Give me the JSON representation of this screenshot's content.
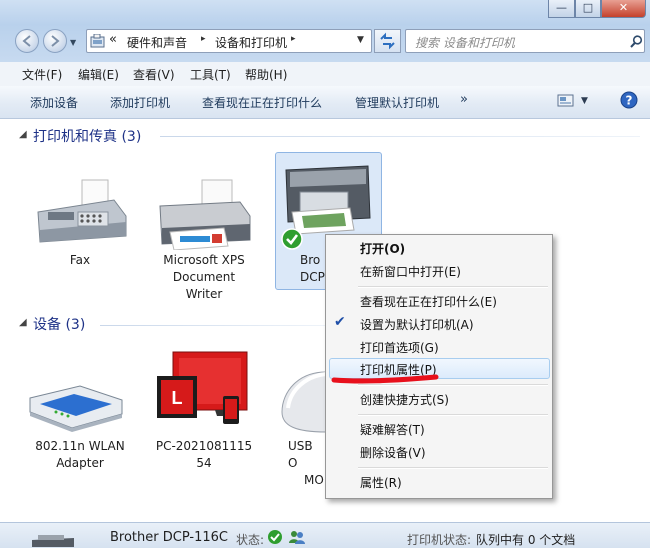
{
  "window": {
    "controls": {
      "minimize": "—",
      "maximize": "□",
      "close": "✕"
    },
    "breadcrumb": {
      "prefix": "«",
      "segments": [
        "硬件和声音",
        "设备和打印机"
      ],
      "separator": "▸"
    },
    "search_placeholder": "搜索 设备和打印机"
  },
  "menubar": [
    "文件(F)",
    "编辑(E)",
    "查看(V)",
    "工具(T)",
    "帮助(H)"
  ],
  "toolbar": {
    "items": [
      "添加设备",
      "添加打印机",
      "查看现在正在打印什么",
      "管理默认打印机"
    ],
    "more": "»"
  },
  "printers_group": {
    "title": "打印机和传真 (3)",
    "devices": [
      {
        "name": "fax",
        "label_lines": [
          "Fax"
        ]
      },
      {
        "name": "xps",
        "label_lines": [
          "Microsoft XPS",
          "Document",
          "Writer"
        ]
      },
      {
        "name": "brother",
        "label_lines": [
          "Bro",
          "DCP-"
        ]
      }
    ]
  },
  "devices_group": {
    "title": "设备 (3)",
    "devices": [
      {
        "name": "wlan",
        "label_lines": [
          "802.11n WLAN",
          "Adapter"
        ]
      },
      {
        "name": "pc",
        "label_lines": [
          "PC-2021081115",
          "54"
        ],
        "logo_letter": "L"
      },
      {
        "name": "usb",
        "label_lines": [
          "USB O",
          "MO"
        ]
      }
    ]
  },
  "context_menu": {
    "items": [
      {
        "label": "打开(O)",
        "bold": true
      },
      {
        "label": "在新窗口中打开(E)"
      },
      {
        "label": "查看现在正在打印什么(E)"
      },
      {
        "label": "设置为默认打印机(A)",
        "checked": true,
        "check_glyph": "✔"
      },
      {
        "label": "打印首选项(G)"
      },
      {
        "label": "打印机属性(P)",
        "highlighted": true
      },
      {
        "label": "创建快捷方式(S)"
      },
      {
        "label": "疑难解答(T)"
      },
      {
        "label": "删除设备(V)"
      },
      {
        "label": "属性(R)"
      }
    ]
  },
  "statusbar": {
    "device_name": "Brother DCP-116C",
    "status_label": "状态:",
    "printer_status_label": "打印机状态:",
    "printer_status_value": "队列中有 0 个文档"
  },
  "colors": {
    "group_title": "#1e3287",
    "selection_fill": "#dbe8f8",
    "underline_annotation": "#e8101c",
    "check_green": "#2f9e2f"
  }
}
